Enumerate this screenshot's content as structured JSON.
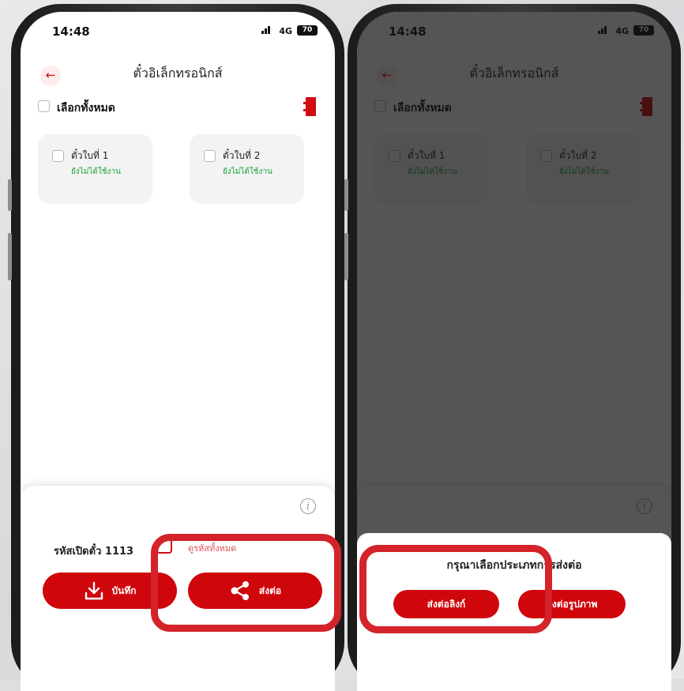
{
  "status": {
    "time": "14:48",
    "network": "4G",
    "battery": "70"
  },
  "header": {
    "back_icon": "←",
    "title": "ตั๋วอิเล็กทรอนิกส์"
  },
  "select_all": {
    "label": "เลือกทั้งหมด"
  },
  "tickets": [
    {
      "name": "ตั๋วใบที่ 1",
      "status": "ยังไม่ได้ใช้งาน"
    },
    {
      "name": "ตั๋วใบที่ 2",
      "status": "ยังไม่ได้ใช้งาน"
    }
  ],
  "sheet": {
    "info_icon": "i",
    "open_code": "รหัสเปิดตั๋ว 1113",
    "code_sub": "ดูรหัสทั้งหมด",
    "save_label": "บันทึก",
    "share_label": "ส่งต่อ"
  },
  "share_sheet": {
    "prompt": "กรุณาเลือกประเภทการส่งต่อ",
    "share_link_label": "ส่งต่อลิงก์",
    "share_image_label": "ส่งต่อรูปภาพ"
  },
  "colors": {
    "accent": "#d0060d",
    "highlight": "#d4232a",
    "unused_status": "#1aa33a"
  }
}
